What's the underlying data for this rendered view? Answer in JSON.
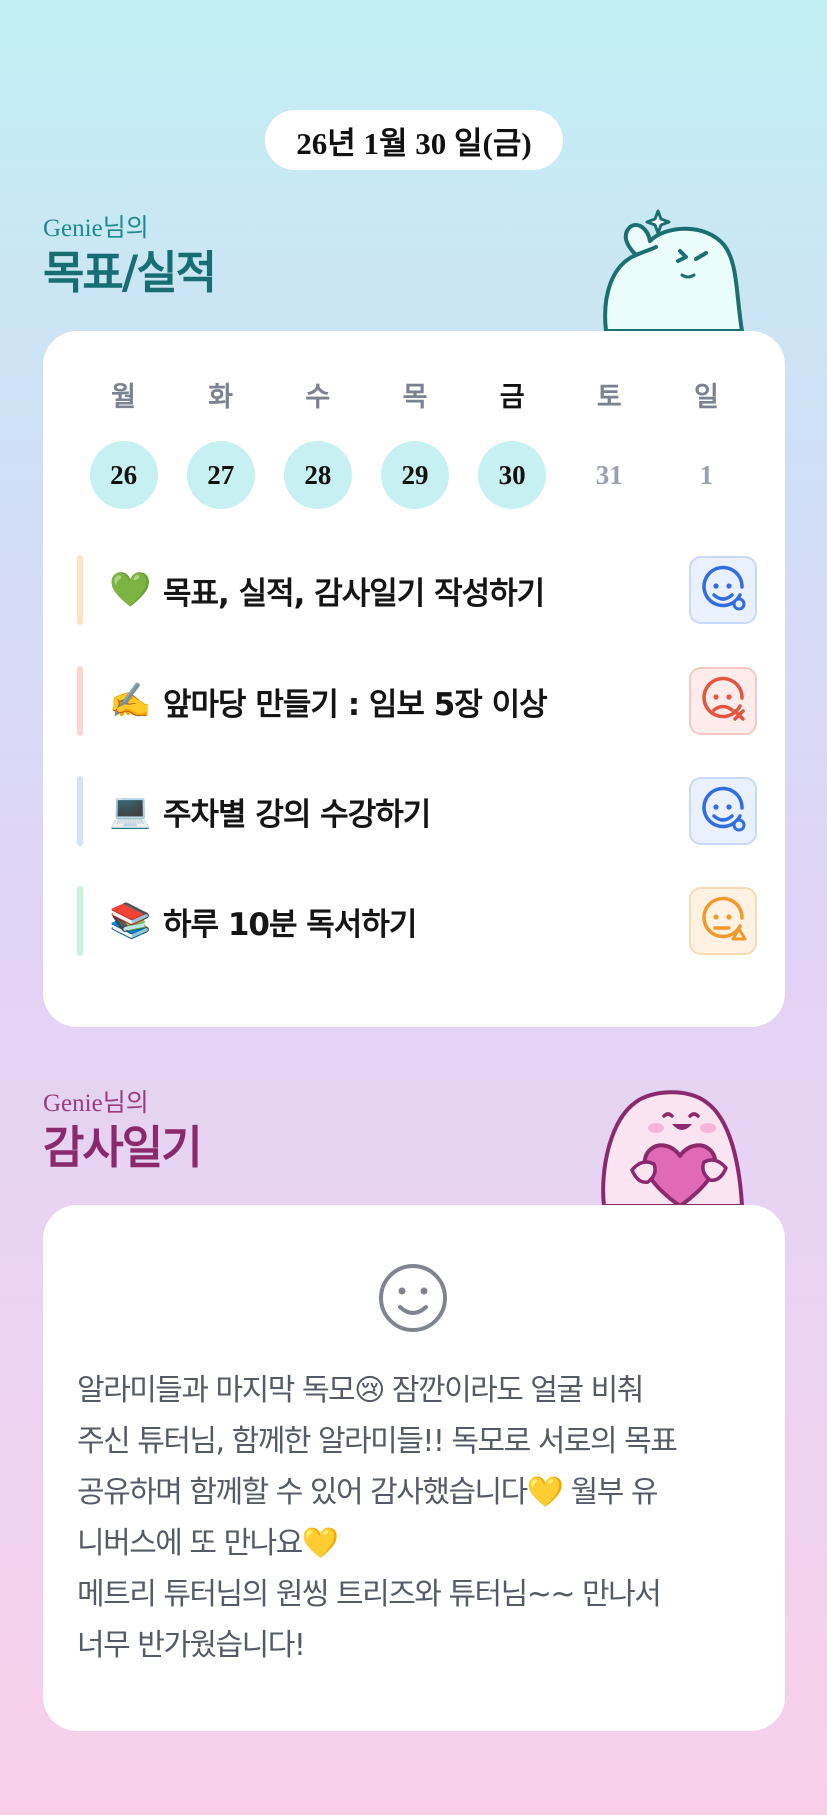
{
  "date_label": "26년 1월 30 일(금)",
  "goals_section": {
    "subtitle": "Genie님의",
    "title": "목표/실적",
    "colors": {
      "accent": "#1f8a8e"
    }
  },
  "week": {
    "days": [
      {
        "label": "월",
        "date": "26",
        "state": "on",
        "active": false
      },
      {
        "label": "화",
        "date": "27",
        "state": "on",
        "active": false
      },
      {
        "label": "수",
        "date": "28",
        "state": "on",
        "active": false
      },
      {
        "label": "목",
        "date": "29",
        "state": "on",
        "active": false
      },
      {
        "label": "금",
        "date": "30",
        "state": "on",
        "active": true
      },
      {
        "label": "토",
        "date": "31",
        "state": "off",
        "active": false
      },
      {
        "label": "일",
        "date": "1",
        "state": "off",
        "active": false
      }
    ]
  },
  "goals": [
    {
      "emoji": "💚",
      "text": "목표, 실적, 감사일기 작성하기",
      "bar_color": "#fde3c2",
      "status": "happy-icon",
      "status_color": "#2f6de0"
    },
    {
      "emoji": "✍️",
      "text": "앞마당 만들기 : 임보 5장 이상",
      "bar_color": "#fbd6d2",
      "status": "sad-x-icon",
      "status_color": "#e2553f"
    },
    {
      "emoji": "💻",
      "text": "주차별 강의 수강하기",
      "bar_color": "#d6e0fb",
      "status": "happy-icon",
      "status_color": "#2f6de0"
    },
    {
      "emoji": "📚",
      "text": "하루 10분 독서하기",
      "bar_color": "#c9f2dc",
      "status": "neutral-warning-icon",
      "status_color": "#f09a2b"
    }
  ],
  "diary_section": {
    "subtitle": "Genie님의",
    "title": "감사일기",
    "colors": {
      "accent": "#9b3a7c"
    },
    "mood_icon": "smile-icon",
    "text": "알라미들과 마지막 독모😢 잠깐이라도 얼굴 비춰\n주신 튜터님, 함께한 알라미들!! 독모로 서로의 목표\n공유하며 함께할 수 있어 감사했습니다💛 월부 유\n니버스에 또 만나요💛\n메트리 튜터님의 원씽 트리즈와 튜터님~~ 만나서\n너무 반가웠습니다!"
  }
}
